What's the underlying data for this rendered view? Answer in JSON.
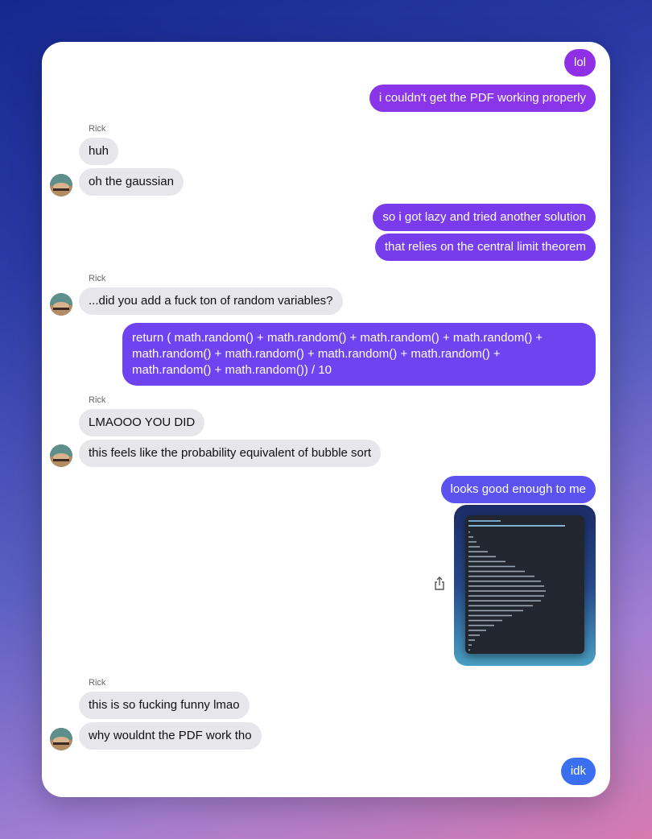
{
  "messages": {
    "m1": "lol",
    "m2": "i couldn't get the PDF working properly",
    "m3": "huh",
    "m4": "oh the gaussian",
    "m5": "so i got lazy and tried another solution",
    "m6": "that relies on the central limit theorem",
    "m7": "...did you add a fuck ton of random variables?",
    "m8_line1": "return ( math.random() + math.random() + math.random() + math.random() +",
    "m8_line2": "math.random() + math.random() + math.random() + math.random() +",
    "m8_line3": "math.random() + math.random()) / 10",
    "m9": "LMAOOO YOU DID",
    "m10": "this feels like the probability equivalent of bubble sort",
    "m11": "looks good enough to me",
    "m12": "this is so fucking funny lmao",
    "m13": "why wouldnt the PDF work tho",
    "m14": "idk"
  },
  "sender_name": "Rick",
  "icons": {
    "share": "share-icon",
    "avatar": "avatar"
  },
  "colors": {
    "outgoing_purple": "#8b2be2",
    "outgoing_violet": "#6b3ff0",
    "outgoing_blue": "#3b6ef0",
    "incoming_gray": "#e6e6eb"
  }
}
